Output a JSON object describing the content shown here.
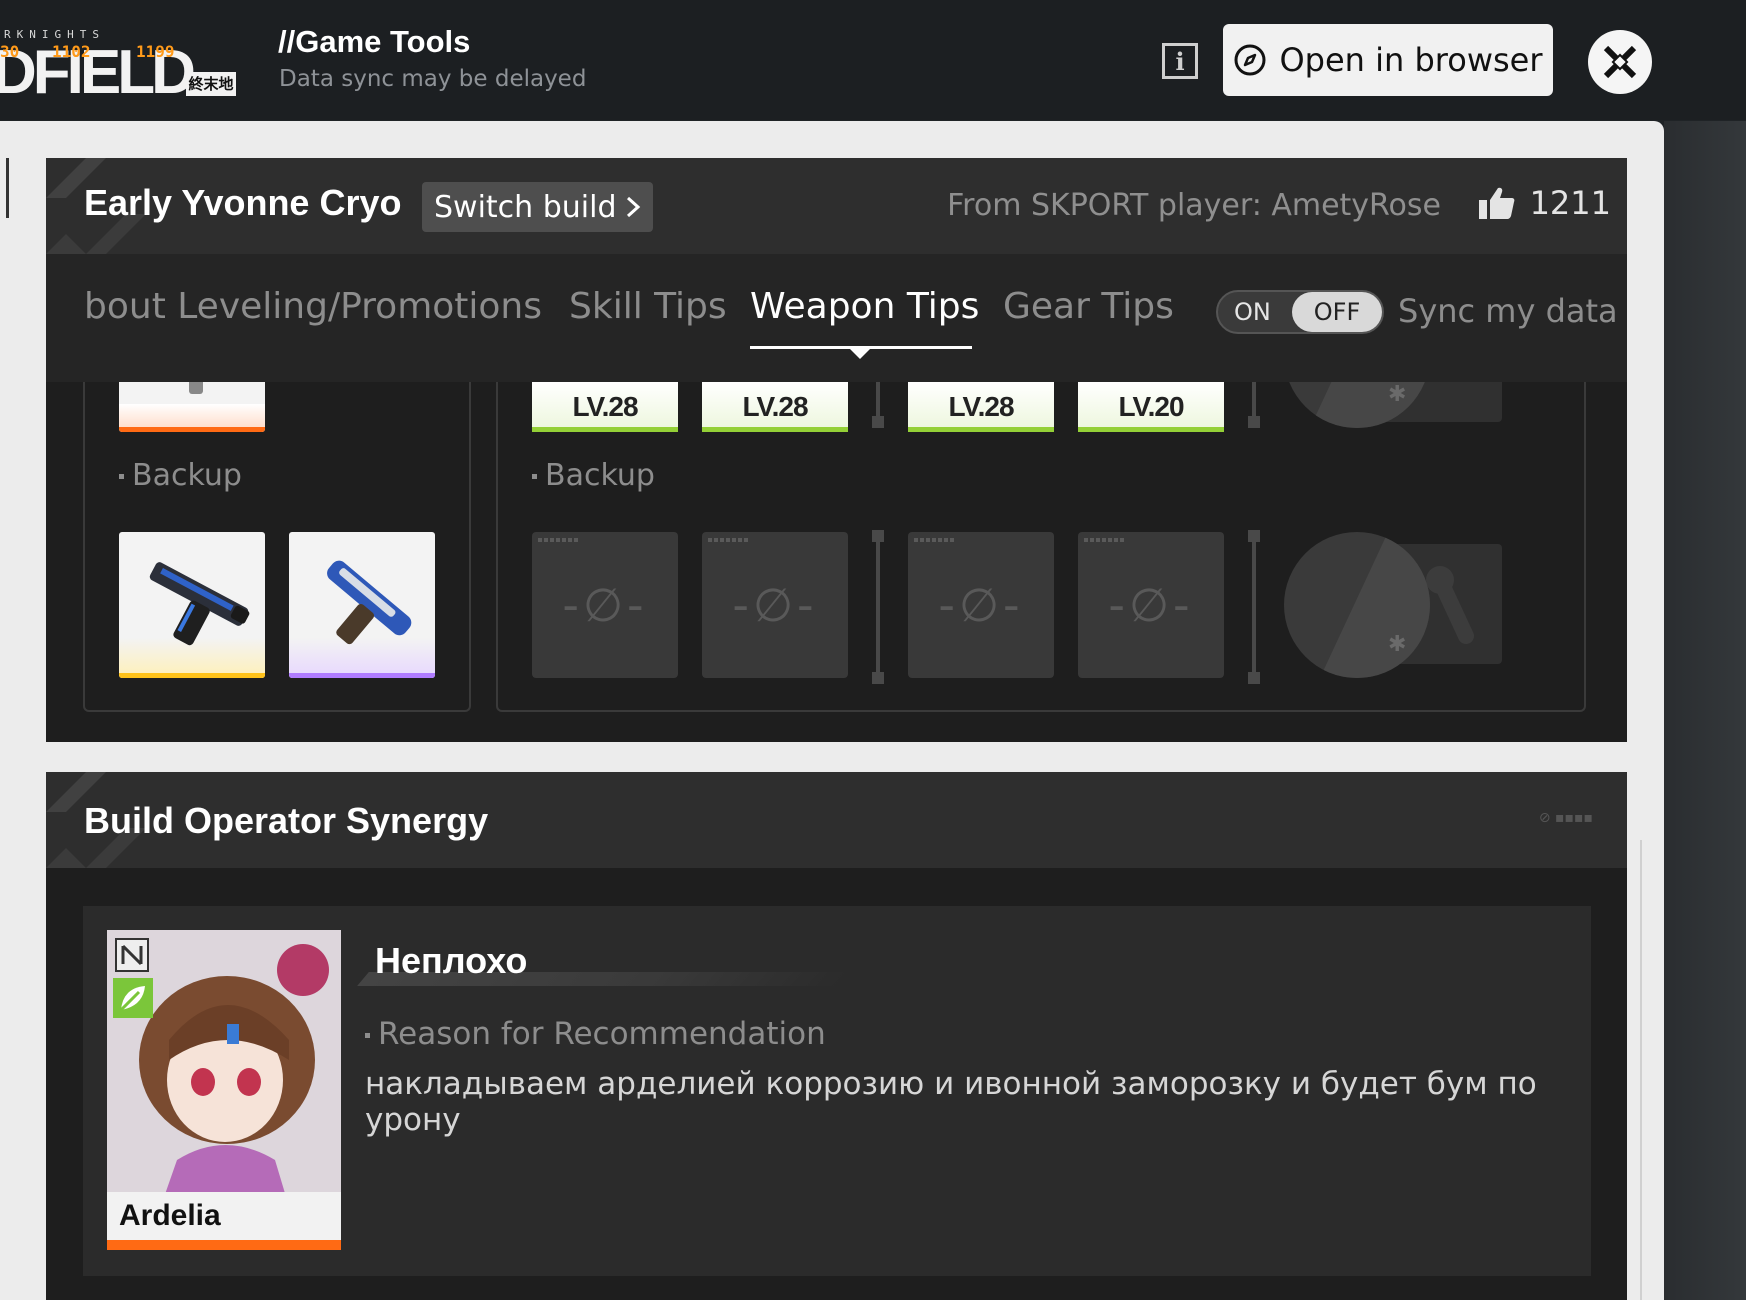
{
  "topbar": {
    "logo_small": "RKNIGHTS",
    "logo_main": "DFIELD",
    "logo_kanji": "終末地",
    "fps_values": [
      "30",
      "1102",
      "1199"
    ],
    "title": "//Game Tools",
    "subtitle": "Data sync may be delayed",
    "open_browser_label": "Open in browser"
  },
  "build": {
    "title": "Early Yvonne Cryo",
    "switch_label": "Switch build",
    "from_player": "From SKPORT player: AmetyRose",
    "likes": "1211",
    "tabs": [
      {
        "label": "bout Leveling/Promotions",
        "active": false
      },
      {
        "label": "Skill Tips",
        "active": false
      },
      {
        "label": "Weapon Tips",
        "active": true
      },
      {
        "label": "Gear Tips",
        "active": false
      }
    ],
    "toggle_on": "ON",
    "toggle_off": "OFF",
    "sync_label": "Sync my data",
    "weapon_backup_label": "Backup",
    "gear_backup_label": "Backup",
    "gear_levels": [
      "LV.28",
      "LV.28",
      "LV.28",
      "LV.20"
    ],
    "empty_symbol": "-∅-",
    "colors": {
      "weapon_top_rarity": "#ff6a14",
      "weapon_backup_1_rarity": "#ffc21a",
      "weapon_backup_2_rarity": "#b07cff",
      "gear_level_bar": "#94d037"
    }
  },
  "synergy": {
    "title": "Build Operator Synergy",
    "operator_name": "Ardelia",
    "rating": "Неплохо",
    "reason_label": "Reason for Recommendation",
    "reason_text": "накладываем арделией коррозию и ивонной заморозку и будет бум по урону",
    "accent_color": "#ff6a14"
  }
}
